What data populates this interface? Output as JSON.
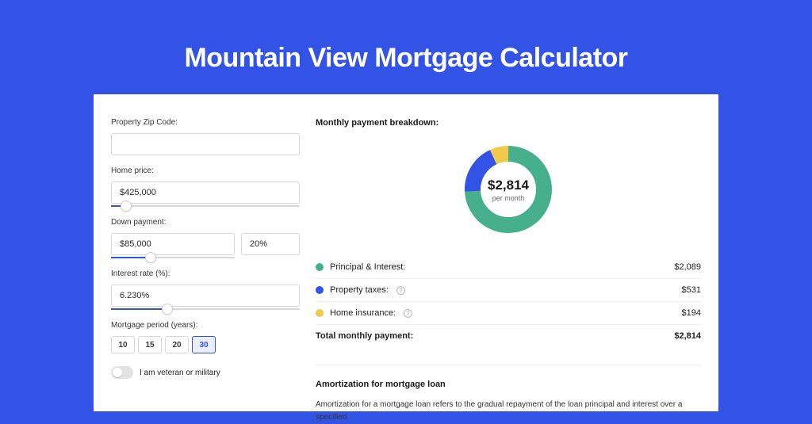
{
  "hero": {
    "title": "Mountain View Mortgage Calculator"
  },
  "form": {
    "zip_label": "Property Zip Code:",
    "zip_value": "",
    "price_label": "Home price:",
    "price_value": "$425,000",
    "price_slider_pct": 8,
    "down_label": "Down payment:",
    "down_value": "$85,000",
    "down_pct_value": "20%",
    "down_slider_pct": 20,
    "rate_label": "Interest rate (%):",
    "rate_value": "6.230%",
    "rate_slider_pct": 30,
    "period_label": "Mortgage period (years):",
    "period_options": [
      "10",
      "15",
      "20",
      "30"
    ],
    "period_selected": "30",
    "veteran_label": "I am veteran or military"
  },
  "breakdown": {
    "title": "Monthly payment breakdown:",
    "center_amount": "$2,814",
    "center_sub": "per month",
    "items": [
      {
        "label": "Principal & Interest:",
        "value": "$2,089",
        "color": "green",
        "info": false
      },
      {
        "label": "Property taxes:",
        "value": "$531",
        "color": "blue",
        "info": true
      },
      {
        "label": "Home insurance:",
        "value": "$194",
        "color": "yellow",
        "info": true
      }
    ],
    "total_label": "Total monthly payment:",
    "total_value": "$2,814"
  },
  "chart_data": {
    "type": "pie",
    "title": "Monthly payment breakdown",
    "series": [
      {
        "name": "Principal & Interest",
        "value": 2089,
        "color": "#46b08c"
      },
      {
        "name": "Property taxes",
        "value": 531,
        "color": "#3353e6"
      },
      {
        "name": "Home insurance",
        "value": 194,
        "color": "#f0c94d"
      }
    ],
    "total": 2814,
    "unit": "USD per month"
  },
  "amortization": {
    "title": "Amortization for mortgage loan",
    "text": "Amortization for a mortgage loan refers to the gradual repayment of the loan principal and interest over a specified"
  }
}
